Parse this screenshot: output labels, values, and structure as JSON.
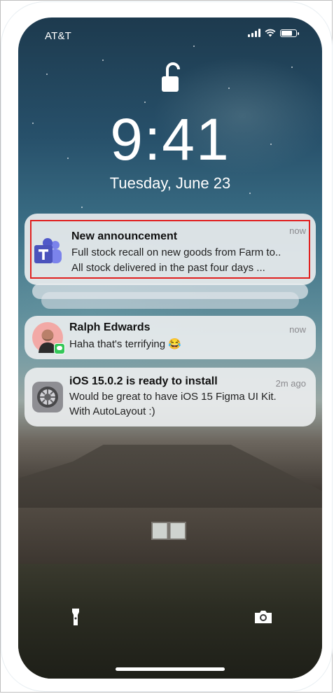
{
  "status_bar": {
    "carrier": "AT&T",
    "signal_icon": "cellular-signal-icon",
    "wifi_icon": "wifi-icon",
    "battery_icon": "battery-icon"
  },
  "lock_screen": {
    "lock_icon": "unlocked-padlock-icon",
    "time": "9:41",
    "date": "Tuesday, June 23"
  },
  "notifications": [
    {
      "app_icon": "microsoft-teams-icon",
      "title": "New announcement",
      "time": "now",
      "lines": [
        "Full stock recall on new goods from Farm to..",
        "All stock delivered in the past four days ..."
      ]
    },
    {
      "app_icon": "contact-avatar-messages-icon",
      "title": "Ralph Edwards",
      "time": "now",
      "lines": [
        "Haha that's terrifying 😂"
      ]
    },
    {
      "app_icon": "settings-gear-icon",
      "title": "iOS 15.0.2 is ready to install",
      "time": "2m ago",
      "lines": [
        "Would be great to have iOS 15 Figma UI Kit.",
        "With AutoLayout :)"
      ]
    }
  ],
  "controls": {
    "flashlight_icon": "flashlight-icon",
    "camera_icon": "camera-icon"
  },
  "colors": {
    "highlight": "#e0201f",
    "teams": "#5059c9",
    "messages_green": "#34c759"
  }
}
